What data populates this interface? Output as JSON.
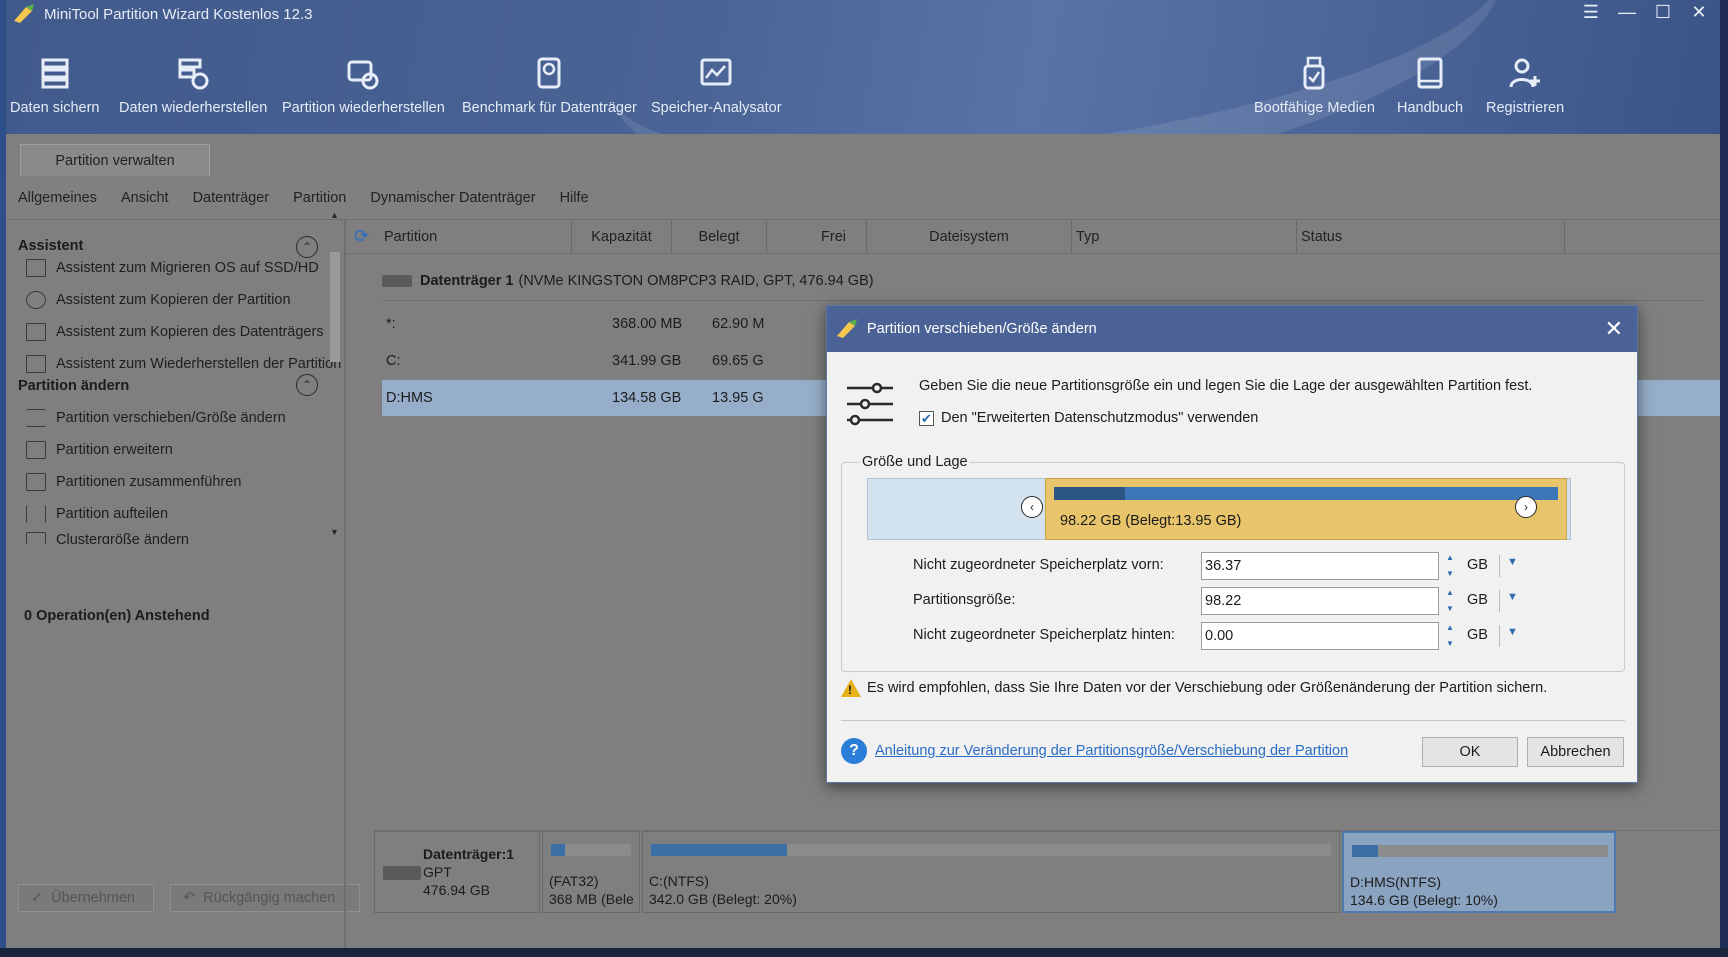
{
  "app": {
    "title": "MiniTool Partition Wizard Kostenlos 12.3"
  },
  "toolbar": {
    "items": [
      {
        "label": "Daten sichern"
      },
      {
        "label": "Daten wiederherstellen"
      },
      {
        "label": "Partition wiederherstellen"
      },
      {
        "label": "Benchmark für Datenträger"
      },
      {
        "label": "Speicher-Analysator"
      },
      {
        "label": "Bootfähige Medien"
      },
      {
        "label": "Handbuch"
      },
      {
        "label": "Registrieren"
      }
    ]
  },
  "tab": {
    "label": "Partition verwalten"
  },
  "menu": [
    "Allgemeines",
    "Ansicht",
    "Datenträger",
    "Partition",
    "Dynamischer Datenträger",
    "Hilfe"
  ],
  "sidebar": {
    "section1": "Assistent",
    "wizards": [
      {
        "label": "Assistent zum Migrieren OS auf SSD/HD"
      },
      {
        "label": "Assistent zum Kopieren der Partition"
      },
      {
        "label": "Assistent zum Kopieren des Datenträgers"
      },
      {
        "label": "Assistent zum Wiederherstellen der Partition"
      }
    ],
    "section2": "Partition ändern",
    "actions": [
      {
        "label": "Partition verschieben/Größe ändern"
      },
      {
        "label": "Partition erweitern"
      },
      {
        "label": "Partitionen zusammenführen"
      },
      {
        "label": "Partition aufteilen"
      },
      {
        "label": "Clustergröße ändern"
      }
    ],
    "pending": "0 Operation(en) Anstehend",
    "apply": "Übernehmen",
    "undo": "Rückgängig machen"
  },
  "table": {
    "columns": [
      "Partition",
      "Kapazität",
      "Belegt",
      "Frei",
      "Dateisystem",
      "Typ",
      "Status"
    ],
    "disk_name": "Datenträger 1",
    "disk_desc": "(NVMe KINGSTON OM8PCP3 RAID, GPT, 476.94 GB)",
    "rows": [
      {
        "partition": "*:",
        "capacity": "368.00 MB",
        "used": "62.90 M"
      },
      {
        "partition": "C:",
        "capacity": "341.99 GB",
        "used": "69.65 G"
      },
      {
        "partition": "D:HMS",
        "capacity": "134.58 GB",
        "used": "13.95 G"
      }
    ]
  },
  "diskmap": {
    "name": "Datenträger:1",
    "scheme": "GPT",
    "size": "476.94 GB",
    "parts": [
      {
        "line1": "(FAT32)",
        "line2": "368 MB (Bele",
        "used_fraction": 0.17
      },
      {
        "line1": "C:(NTFS)",
        "line2": "342.0 GB (Belegt: 20%)",
        "used_fraction": 0.2
      },
      {
        "line1": "D:HMS(NTFS)",
        "line2": "134.6 GB (Belegt: 10%)",
        "used_fraction": 0.1
      }
    ]
  },
  "dialog": {
    "title": "Partition verschieben/Größe ändern",
    "description": "Geben Sie die neue Partitionsgröße ein und legen Sie die Lage der ausgewählten Partition fest.",
    "checkbox_label": "Den \"Erweiterten Datenschutzmodus\" verwenden",
    "checkbox_checked": true,
    "group_label": "Größe und Lage",
    "partition_block_text": "98.22 GB (Belegt:13.95 GB)",
    "used_fraction": 0.14,
    "fields": [
      {
        "label": "Nicht zugeordneter Speicherplatz vorn:",
        "value": "36.37",
        "unit": "GB"
      },
      {
        "label": "Partitionsgröße:",
        "value": "98.22",
        "unit": "GB"
      },
      {
        "label": "Nicht zugeordneter Speicherplatz hinten:",
        "value": "0.00",
        "unit": "GB"
      }
    ],
    "warning": "Es wird empfohlen, dass Sie Ihre Daten vor der Verschiebung oder Größenänderung der Partition sichern.",
    "help_link": "Anleitung zur Veränderung der Partitionsgröße/Verschiebung der Partition",
    "ok": "OK",
    "cancel": "Abbrechen"
  }
}
